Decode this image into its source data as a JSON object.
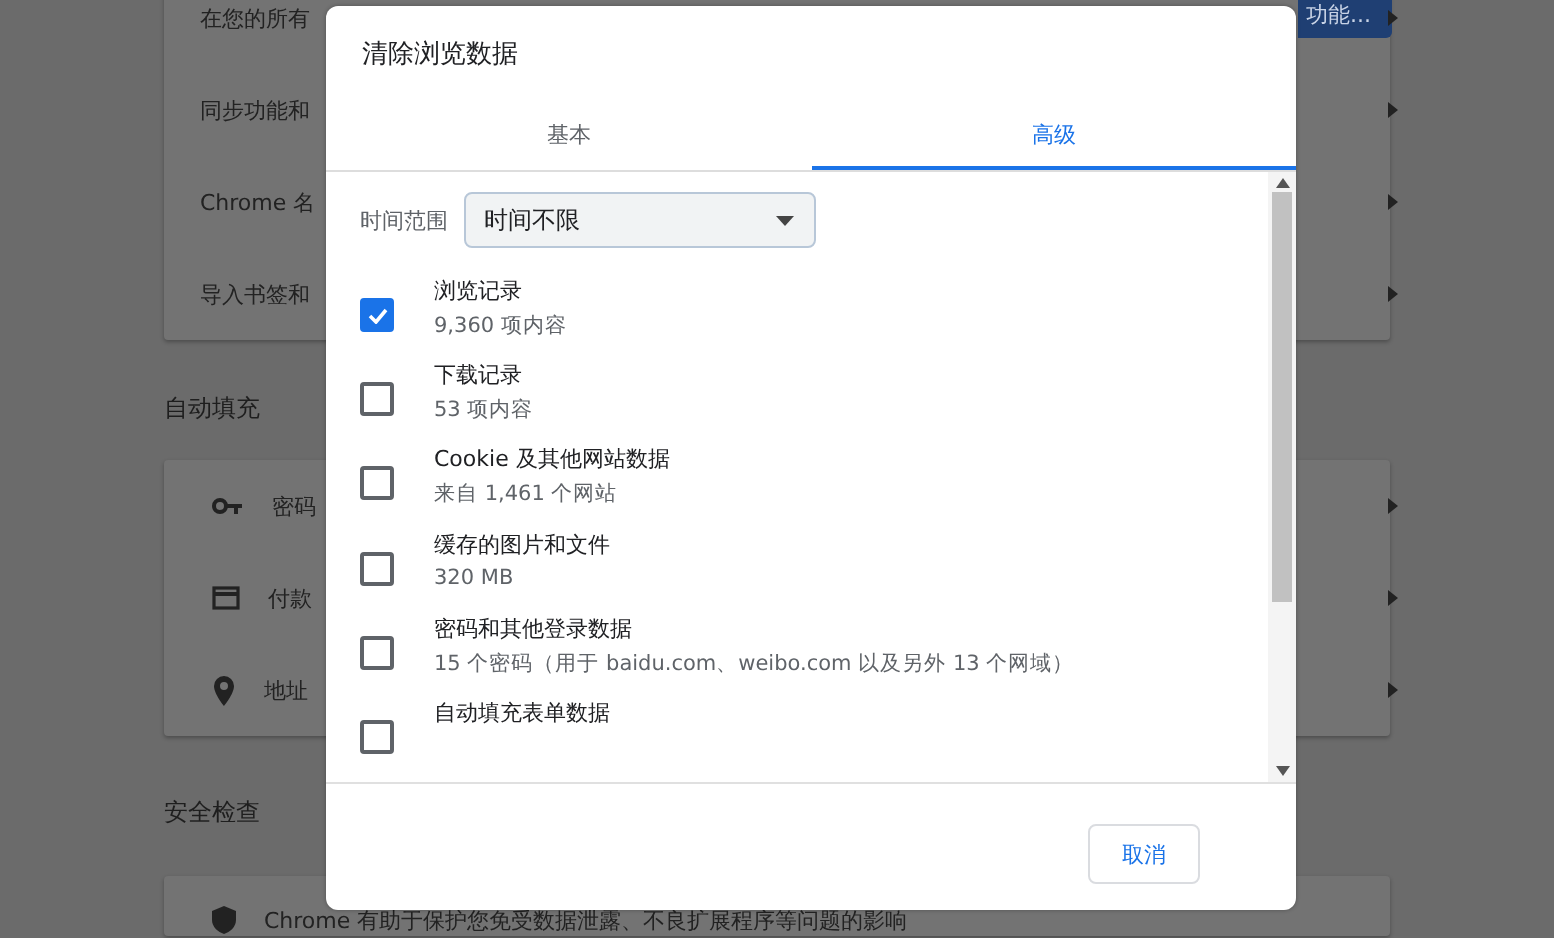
{
  "background": {
    "top_button": "功能...",
    "sections": [
      {
        "rows": [
          {
            "label": "在您的所有"
          },
          {
            "label": "同步功能和"
          },
          {
            "label": "Chrome 名"
          },
          {
            "label": "导入书签和"
          }
        ]
      },
      {
        "heading": "自动填充",
        "rows": [
          {
            "label": "密码"
          },
          {
            "label": "付款"
          },
          {
            "label": "地址"
          }
        ]
      },
      {
        "heading": "安全检查",
        "rows": [
          {
            "label": "Chrome 有助于保护您免受数据泄露、不良扩展程序等问题的影响"
          }
        ]
      }
    ]
  },
  "dialog": {
    "title": "清除浏览数据",
    "tabs": [
      {
        "label": "基本",
        "selected": false
      },
      {
        "label": "高级",
        "selected": true
      }
    ],
    "time_range": {
      "label": "时间范围",
      "value": "时间不限"
    },
    "items": [
      {
        "title": "浏览记录",
        "detail": "9,360 项内容",
        "checked": true
      },
      {
        "title": "下载记录",
        "detail": "53 项内容",
        "checked": false
      },
      {
        "title": "Cookie 及其他网站数据",
        "detail": "来自 1,461 个网站",
        "checked": false
      },
      {
        "title": "缓存的图片和文件",
        "detail": "320 MB",
        "checked": false
      },
      {
        "title": "密码和其他登录数据",
        "detail": "15 个密码（用于 baidu.com、weibo.com 以及另外 13 个网域）",
        "checked": false
      },
      {
        "title": "自动填充表单数据",
        "checked": false
      }
    ],
    "cancel_button": "取消"
  }
}
